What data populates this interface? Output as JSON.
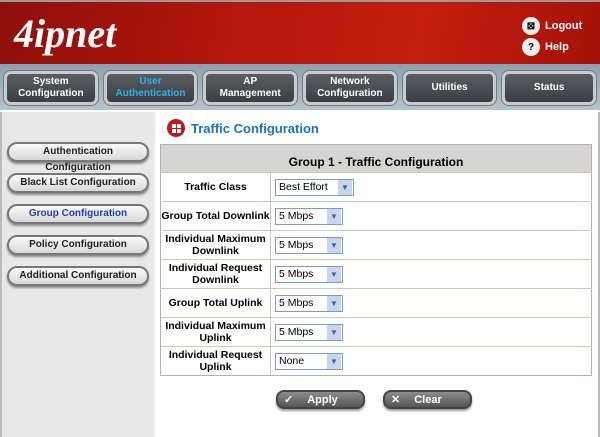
{
  "header": {
    "logo": "4ipnet",
    "logout": "Logout",
    "help": "Help"
  },
  "nav": [
    {
      "l1": "System",
      "l2": "Configuration"
    },
    {
      "l1": "User",
      "l2": "Authentication",
      "active": true
    },
    {
      "l1": "AP",
      "l2": "Management"
    },
    {
      "l1": "Network",
      "l2": "Configuration"
    },
    {
      "l1": "Utilities",
      "l2": ""
    },
    {
      "l1": "Status",
      "l2": ""
    }
  ],
  "sidebar": [
    "Authentication Configuration",
    "Black List Configuration",
    "Group Configuration",
    "Policy Configuration",
    "Additional Configuration"
  ],
  "main": {
    "title": "Traffic Configuration",
    "table_title": "Group 1 - Traffic Configuration",
    "rows": [
      {
        "label": "Traffic Class",
        "value": "Best Effort"
      },
      {
        "label": "Group Total Downlink",
        "value": "5 Mbps"
      },
      {
        "label": "Individual Maximum Downlink",
        "value": "5 Mbps"
      },
      {
        "label": "Individual Request Downlink",
        "value": "5 Mbps"
      },
      {
        "label": "Group Total Uplink",
        "value": "5 Mbps"
      },
      {
        "label": "Individual Maximum Uplink",
        "value": "5 Mbps"
      },
      {
        "label": "Individual Request Uplink",
        "value": "None"
      }
    ],
    "apply": "Apply",
    "clear": "Clear"
  }
}
